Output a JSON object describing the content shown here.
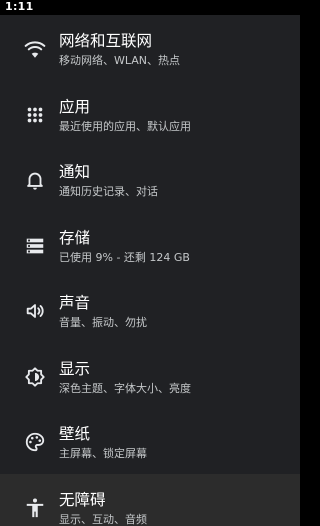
{
  "status_bar": {
    "time": "1:11"
  },
  "theme": {
    "background": "#202124",
    "highlight": "#2c2c2c",
    "title_color": "#ffffff",
    "summary_color": "#c4c7c9"
  },
  "settings": [
    {
      "icon": "wifi-icon",
      "title": "网络和互联网",
      "summary": "移动网络、WLAN、热点"
    },
    {
      "icon": "apps-grid-icon",
      "title": "应用",
      "summary": "最近使用的应用、默认应用"
    },
    {
      "icon": "bell-icon",
      "title": "通知",
      "summary": "通知历史记录、对话"
    },
    {
      "icon": "storage-icon",
      "title": "存储",
      "summary": "已使用 9% - 还剩 124 GB"
    },
    {
      "icon": "volume-icon",
      "title": "声音",
      "summary": "音量、振动、勿扰"
    },
    {
      "icon": "brightness-icon",
      "title": "显示",
      "summary": "深色主题、字体大小、亮度"
    },
    {
      "icon": "palette-icon",
      "title": "壁纸",
      "summary": "主屏幕、锁定屏幕"
    },
    {
      "icon": "accessibility-icon",
      "title": "无障碍",
      "summary": "显示、互动、音频"
    }
  ]
}
